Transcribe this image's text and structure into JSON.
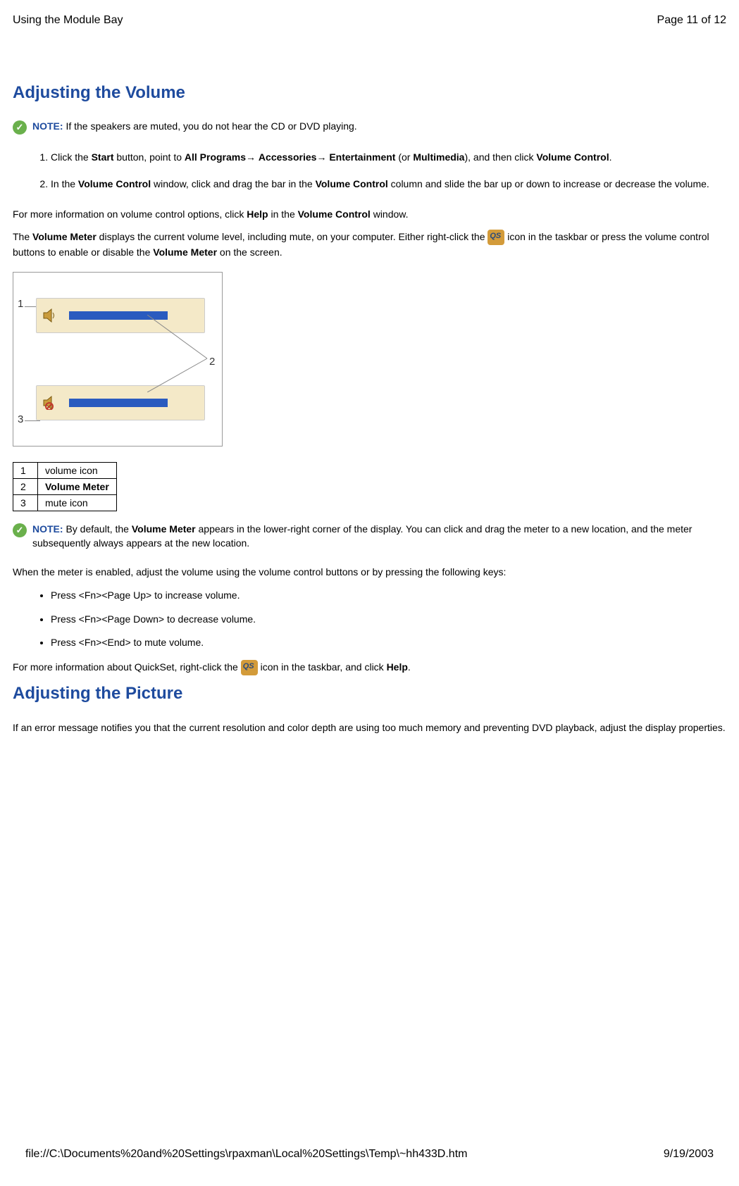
{
  "header": {
    "left": "Using the Module Bay",
    "right": "Page 11 of 12"
  },
  "h2a": "Adjusting the Volume",
  "note1": {
    "label": "NOTE:",
    "text": " If the speakers are muted, you do not hear the CD or DVD playing."
  },
  "ol1": {
    "i1_a": "Click the ",
    "i1_b": "Start",
    "i1_c": " button, point to ",
    "i1_d": "All Programs",
    "i1_e": "→ ",
    "i1_f": "Accessories",
    "i1_g": "→ ",
    "i1_h": "Entertainment",
    "i1_i": " (or ",
    "i1_j": "Multimedia",
    "i1_k": "), and then click ",
    "i1_l": "Volume Control",
    "i1_m": ".",
    "i2_a": "In the ",
    "i2_b": "Volume Control",
    "i2_c": " window, click and drag the bar in the ",
    "i2_d": "Volume Control",
    "i2_e": " column and slide the bar up or down to increase or decrease the volume."
  },
  "p1": {
    "a": "For more information on volume control options, click ",
    "b": "Help",
    "c": " in the ",
    "d": "Volume Control",
    "e": " window."
  },
  "p2": {
    "a": "The ",
    "b": "Volume Meter",
    "c": " displays the current volume level, including mute, on your computer. Either right-click the ",
    "d": " icon in the taskbar or press the volume control buttons to enable or disable the ",
    "e": "Volume Meter",
    "f": " on the screen."
  },
  "legend": {
    "r1n": "1",
    "r1t": "volume icon",
    "r2n": "2",
    "r2t": "Volume Meter",
    "r3n": "3",
    "r3t": "mute icon"
  },
  "note2": {
    "label": "NOTE:",
    "a": " By default, the ",
    "b": "Volume Meter",
    "c": " appears in the lower-right corner of the display. You can click and drag the meter to a new location, and the meter subsequently always appears at the new location."
  },
  "p3": "When the meter is enabled, adjust the volume using the volume control buttons or by pressing the following keys:",
  "ul1": {
    "i1": "Press <Fn><Page Up> to increase volume.",
    "i2": "Press <Fn><Page Down> to decrease volume.",
    "i3": "Press <Fn><End> to mute volume."
  },
  "p4": {
    "a": "For more information about QuickSet, right-click the ",
    "b": " icon in the taskbar, and click ",
    "c": "Help",
    "d": "."
  },
  "h2b": "Adjusting the Picture",
  "p5": "If an error message notifies you that the current resolution and color depth are using too much memory and preventing DVD playback, adjust the display properties.",
  "footer": {
    "left": "file://C:\\Documents%20and%20Settings\\rpaxman\\Local%20Settings\\Temp\\~hh433D.htm",
    "right": "9/19/2003"
  }
}
